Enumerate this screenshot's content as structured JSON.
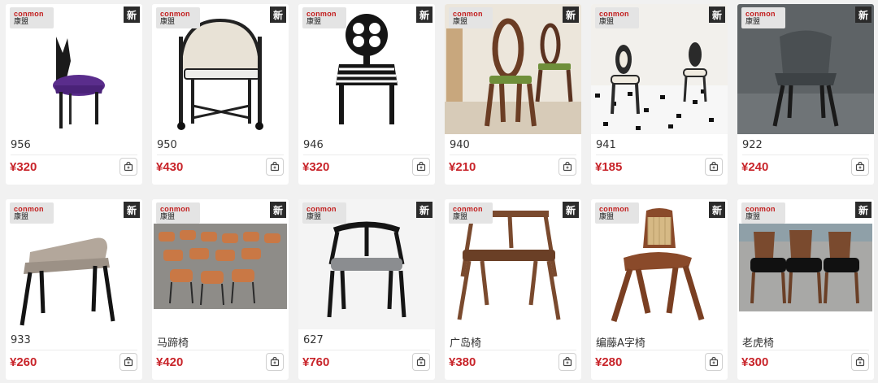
{
  "brand": {
    "en": "conmon",
    "cn": "康盟"
  },
  "badge": "新",
  "products": [
    {
      "name": "956",
      "price": "¥320"
    },
    {
      "name": "950",
      "price": "¥430"
    },
    {
      "name": "946",
      "price": "¥320"
    },
    {
      "name": "940",
      "price": "¥210"
    },
    {
      "name": "941",
      "price": "¥185"
    },
    {
      "name": "922",
      "price": "¥240"
    },
    {
      "name": "933",
      "price": "¥260"
    },
    {
      "name": "马蹄椅",
      "price": "¥420"
    },
    {
      "name": "627",
      "price": "¥760"
    },
    {
      "name": "广岛椅",
      "price": "¥380"
    },
    {
      "name": "编藤A字椅",
      "price": "¥280"
    },
    {
      "name": "老虎椅",
      "price": "¥300"
    }
  ],
  "icons": {
    "cart": "add-to-cart-icon"
  },
  "colors": {
    "price": "#c8242a",
    "badge_bg": "#2b2b2b",
    "brand_accent": "#c21c1c"
  }
}
